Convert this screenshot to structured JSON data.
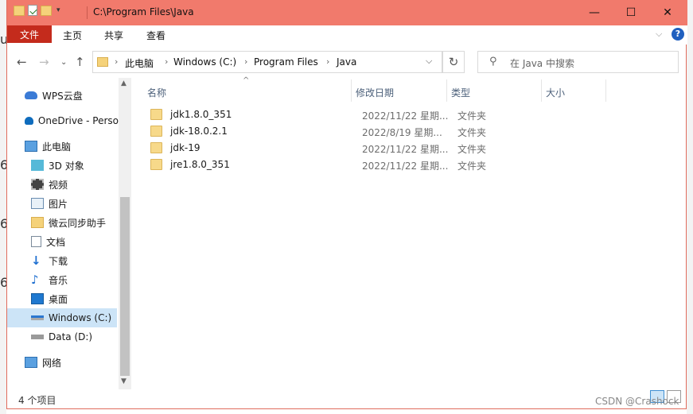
{
  "window": {
    "title_path": "C:\\Program Files\\Java",
    "controls": {
      "minimize": "—",
      "maximize": "☐",
      "close": "✕"
    }
  },
  "ribbon": {
    "tabs": [
      "文件",
      "主页",
      "共享",
      "查看"
    ],
    "help": "?"
  },
  "address": {
    "crumbs": [
      "此电脑",
      "Windows (C:)",
      "Program Files",
      "Java"
    ],
    "separator": "›",
    "search_placeholder": "在 Java 中搜索"
  },
  "nav": {
    "items": [
      {
        "label": "WPS云盘",
        "icon": "cloud-icon"
      },
      {
        "label": "OneDrive - Perso",
        "icon": "onedrive-icon"
      },
      {
        "label": "此电脑",
        "icon": "computer-icon"
      },
      {
        "label": "3D 对象",
        "icon": "3d-objects-icon"
      },
      {
        "label": "视频",
        "icon": "video-icon"
      },
      {
        "label": "图片",
        "icon": "pictures-icon"
      },
      {
        "label": "微云同步助手",
        "icon": "weiyun-icon"
      },
      {
        "label": "文档",
        "icon": "documents-icon"
      },
      {
        "label": "下载",
        "icon": "download-icon"
      },
      {
        "label": "音乐",
        "icon": "music-icon"
      },
      {
        "label": "桌面",
        "icon": "desktop-icon"
      },
      {
        "label": "Windows (C:)",
        "icon": "drive-c-icon"
      },
      {
        "label": "Data (D:)",
        "icon": "drive-d-icon"
      },
      {
        "label": "网络",
        "icon": "network-icon"
      }
    ]
  },
  "columns": [
    "名称",
    "修改日期",
    "类型",
    "大小"
  ],
  "files": [
    {
      "name": "jdk1.8.0_351",
      "date": "2022/11/22 星期...",
      "type": "文件夹"
    },
    {
      "name": "jdk-18.0.2.1",
      "date": "2022/8/19 星期...",
      "type": "文件夹"
    },
    {
      "name": "jdk-19",
      "date": "2022/11/22 星期...",
      "type": "文件夹"
    },
    {
      "name": "jre1.8.0_351",
      "date": "2022/11/22 星期...",
      "type": "文件夹"
    }
  ],
  "status": {
    "count": "4 个项目"
  },
  "watermark": "CSDN @Crashock",
  "colors": {
    "titlebar": "#f17a6c",
    "file_tab": "#c42b1c",
    "selected": "#cce4f7"
  }
}
